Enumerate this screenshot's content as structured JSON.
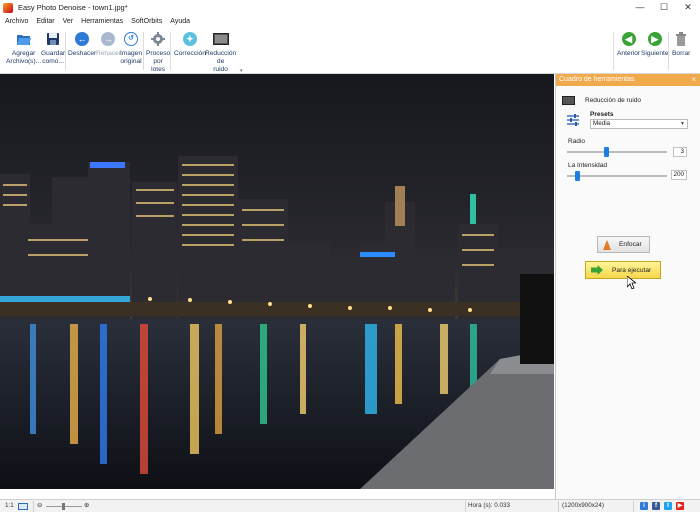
{
  "window": {
    "title": "Easy Photo Denoise - town1.jpg*",
    "minimize": "—",
    "maximize": "☐",
    "close": "✕"
  },
  "menu": [
    "Archivo",
    "Editar",
    "Ver",
    "Herramientas",
    "SoftOrbits",
    "Ayuda"
  ],
  "toolbar": {
    "add_files": [
      "Agregar",
      "Archivo(s)..."
    ],
    "save_as": [
      "Guardar",
      "como..."
    ],
    "undo": "Deshacer",
    "redo": "Rehacer",
    "original": [
      "Imagen",
      "original"
    ],
    "batch": [
      "Proceso",
      "por",
      "lotes"
    ],
    "correction": "Corrección",
    "denoise": [
      "Reducción",
      "de",
      "ruido"
    ],
    "previous": "Anterior",
    "next": "Siguiente",
    "delete": "Borrar"
  },
  "panel": {
    "header": "Cuadro de herramientas",
    "close": "×",
    "tool_title": "Reducción de ruido",
    "presets_label": "Presets",
    "presets_value": "Media",
    "radius_label": "Radio",
    "radius_value": "3",
    "radius_fraction": 0.39,
    "intensity_label": "La Intensidad",
    "intensity_value": "200",
    "intensity_fraction": 0.1,
    "sharpen_button": "Enfocar",
    "run_button": "Para ejecutar"
  },
  "status": {
    "zoom_ratio": "1:1",
    "time": "Hora (s): 0.033",
    "dimensions": "(1200x900x24)"
  },
  "colors": {
    "accent": "#f0a94b",
    "slider": "#1c7fe0",
    "run_button": "#f7d64a"
  }
}
